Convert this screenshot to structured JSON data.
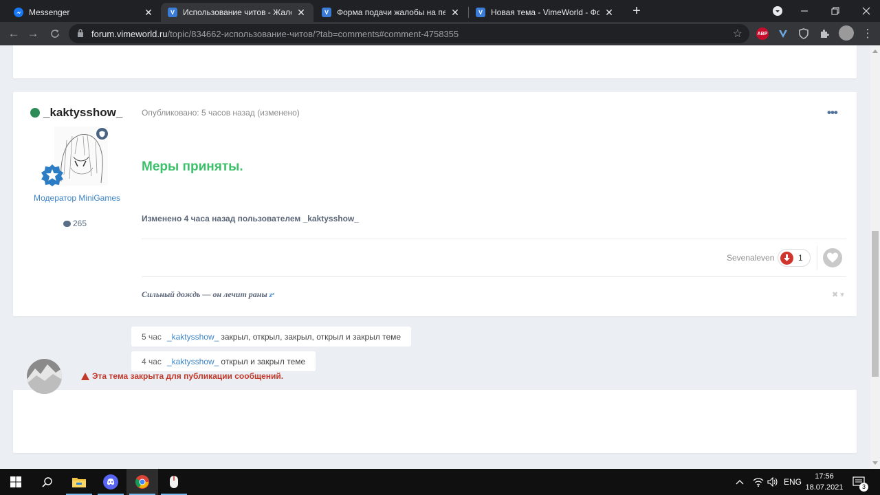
{
  "browser": {
    "tabs": [
      {
        "title": "Messenger",
        "favicon": "messenger-icon",
        "active": false
      },
      {
        "title": "Использование читов - Жалобы",
        "favicon": "vimeworld-icon",
        "active": true
      },
      {
        "title": "Форма подачи жалобы на перс",
        "favicon": "vimeworld-icon",
        "active": false
      },
      {
        "title": "Новая тема - VimeWorld - Фору",
        "favicon": "vimeworld-icon",
        "active": false
      }
    ],
    "url_host": "forum.vimeworld.ru",
    "url_path": "/topic/834662-использование-читов/?tab=comments#comment-4758355",
    "extensions": [
      {
        "name": "adblock-plus-icon",
        "label": "ABP",
        "color": "#c70d2c"
      },
      {
        "name": "vpn-icon",
        "label": "",
        "color": "#2b6cb0"
      },
      {
        "name": "shield-extension-icon",
        "label": "",
        "color": "#5f6368"
      },
      {
        "name": "puzzle-icon",
        "label": "",
        "color": "#35363a"
      }
    ]
  },
  "post": {
    "author": "_kaktysshow_",
    "group": "Модератор MiniGames",
    "post_count": "265",
    "meta": "Опубликовано: 5 часов назад (изменено)",
    "menu_glyph": "•••",
    "content": "Меры приняты.",
    "edited_note": "Изменено 4 часа назад пользователем _kaktysshow_",
    "reaction_user": "Sevenaleven",
    "reaction_count": "1",
    "signature": "Сильный дождь — он лечит раны ",
    "signature_suffix": "zᶻ",
    "sig_controls": "✖ ▾"
  },
  "events": [
    {
      "time": "5 час",
      "user": "_kaktysshow_",
      "action": "закрыл, открыл, закрыл, открыл и закрыл теме"
    },
    {
      "time": "4 час",
      "user": "_kaktysshow_",
      "action": "открыл и закрыл теме"
    }
  ],
  "locked": {
    "message": "Эта тема закрыта для публикации сообщений."
  },
  "taskbar": {
    "language": "ENG",
    "time": "17:56",
    "date": "18.07.2021",
    "notifications": "3"
  },
  "colors": {
    "accent_green": "#3cc16a",
    "link_blue": "#3d85c6",
    "danger_red": "#c0392b",
    "page_bg": "#ebeef2"
  }
}
